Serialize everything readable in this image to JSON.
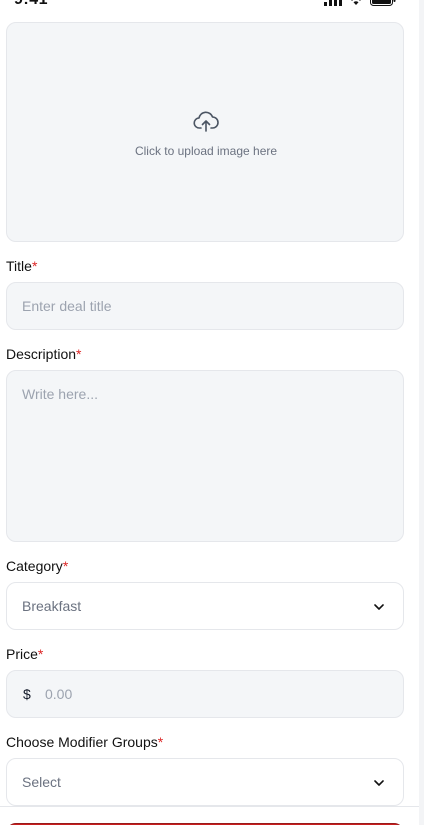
{
  "status_bar": {
    "time": "9:41"
  },
  "upload": {
    "text": "Click to upload image here",
    "icon": "cloud-upload-icon"
  },
  "fields": {
    "title": {
      "label": "Title",
      "required_mark": "*",
      "placeholder": "Enter deal title",
      "value": ""
    },
    "description": {
      "label": "Description",
      "required_mark": "*",
      "placeholder": "Write here...",
      "value": ""
    },
    "category": {
      "label": "Category",
      "required_mark": "*",
      "selected": "Breakfast"
    },
    "price": {
      "label": "Price",
      "required_mark": "*",
      "currency": "$",
      "placeholder": "0.00",
      "value": ""
    },
    "modifier_groups": {
      "label": "Choose Modifier Groups",
      "required_mark": "*",
      "selected": "Select"
    }
  },
  "colors": {
    "accent": "#c81e1e",
    "required": "#dc2626",
    "field_bg": "#f4f6f8",
    "border": "#e5e7eb"
  }
}
